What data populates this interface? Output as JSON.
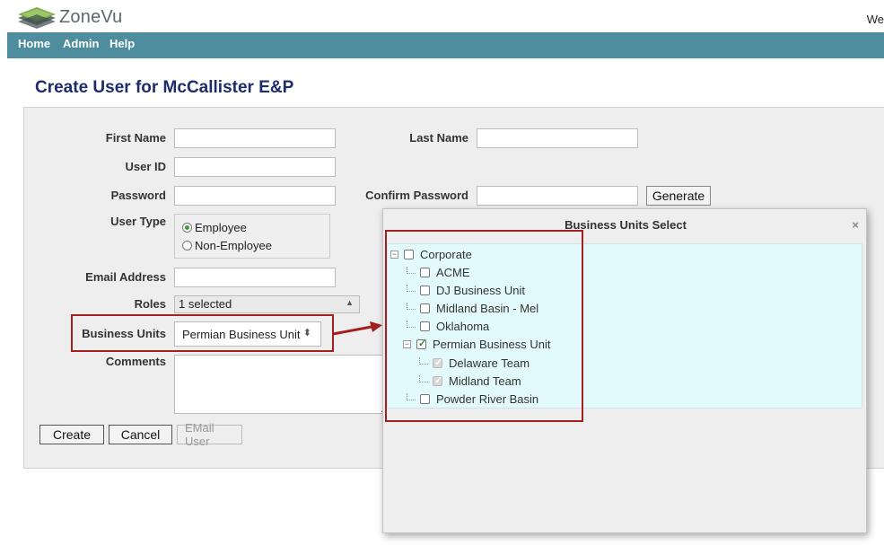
{
  "app": {
    "name": "ZoneVu",
    "welcome": "We"
  },
  "nav": {
    "items": [
      {
        "label": "Home"
      },
      {
        "label": "Admin"
      },
      {
        "label": "Help"
      }
    ]
  },
  "page": {
    "title": "Create User for McCallister E&P"
  },
  "form": {
    "first_name": {
      "label": "First Name",
      "value": ""
    },
    "last_name": {
      "label": "Last Name",
      "value": ""
    },
    "user_id": {
      "label": "User ID",
      "value": ""
    },
    "password": {
      "label": "Password",
      "value": ""
    },
    "confirm_password": {
      "label": "Confirm Password",
      "value": ""
    },
    "generate_label": "Generate",
    "user_type": {
      "label": "User Type",
      "options": [
        {
          "label": "Employee",
          "selected": true
        },
        {
          "label": "Non-Employee",
          "selected": false
        }
      ]
    },
    "email": {
      "label": "Email Address",
      "value": ""
    },
    "roles": {
      "label": "Roles",
      "value": "1 selected"
    },
    "business_units": {
      "label": "Business Units",
      "value": "Permian Business Unit"
    },
    "comments": {
      "label": "Comments",
      "value": ""
    },
    "buttons": {
      "create": "Create",
      "cancel": "Cancel",
      "email_user": "EMail User"
    }
  },
  "dialog": {
    "title": "Business Units Select",
    "close": "×",
    "tree": [
      {
        "label": "Corporate",
        "checked": false
      },
      {
        "label": "ACME",
        "checked": false
      },
      {
        "label": "DJ Business Unit",
        "checked": false
      },
      {
        "label": "Midland Basin - Mel",
        "checked": false
      },
      {
        "label": "Oklahoma",
        "checked": false
      },
      {
        "label": "Permian Business Unit",
        "checked": true
      },
      {
        "label": "Delaware Team",
        "checked": true
      },
      {
        "label": "Midland Team",
        "checked": true
      },
      {
        "label": "Powder River Basin",
        "checked": false
      }
    ]
  },
  "colors": {
    "nav_bg": "#4d8d9e",
    "title": "#1d2c6b",
    "highlight": "#a32020",
    "tree_bg": "#e2fafb"
  }
}
